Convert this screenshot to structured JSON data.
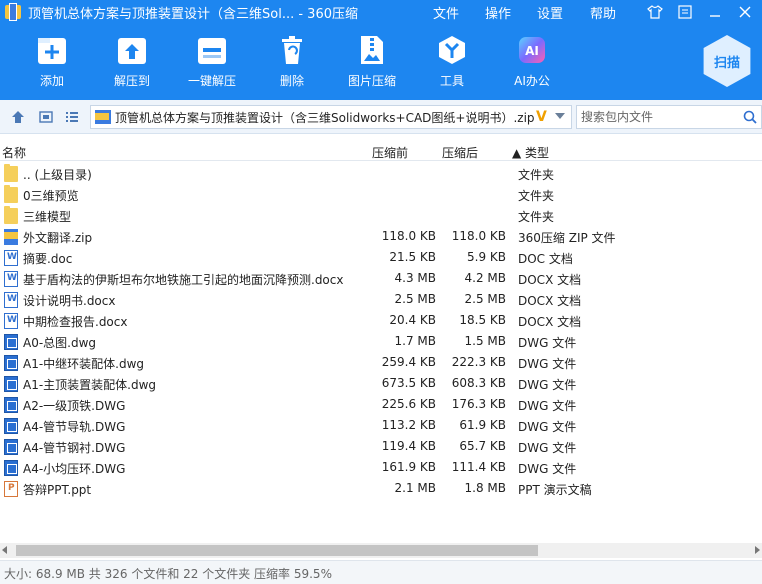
{
  "window": {
    "title": "顶管机总体方案与顶推装置设计（含三维Sol... - 360压缩",
    "menu": [
      "文件",
      "操作",
      "设置",
      "帮助"
    ]
  },
  "toolbar": {
    "add": "添加",
    "extract": "解压到",
    "one_click_extract": "一键解压",
    "delete": "删除",
    "image_compress": "图片压缩",
    "tools": "工具",
    "ai_office": "AI办公",
    "ai_badge": "AI",
    "scan": "扫描"
  },
  "address": {
    "path": "顶管机总体方案与顶推装置设计（含三维Solidworks+CAD图纸+说明书）.zip",
    "search_placeholder": "搜索包内文件"
  },
  "columns": {
    "name": "名称",
    "compressed_before": "压缩前",
    "compressed_after": "压缩后",
    "type": "▲ 类型"
  },
  "files": [
    {
      "name": ".. (上级目录)",
      "size_before": "",
      "size_after": "",
      "type": "文件夹",
      "icon": "folder-icon"
    },
    {
      "name": "0三维预览",
      "size_before": "",
      "size_after": "",
      "type": "文件夹",
      "icon": "folder-icon"
    },
    {
      "name": "三维模型",
      "size_before": "",
      "size_after": "",
      "type": "文件夹",
      "icon": "folder-icon"
    },
    {
      "name": "外文翻译.zip",
      "size_before": "118.0 KB",
      "size_after": "118.0 KB",
      "type": "360压缩 ZIP 文件",
      "icon": "zip-icon"
    },
    {
      "name": "摘要.doc",
      "size_before": "21.5 KB",
      "size_after": "5.9 KB",
      "type": "DOC 文档",
      "icon": "word-doc-icon"
    },
    {
      "name": "基于盾构法的伊斯坦布尔地铁施工引起的地面沉降预测.docx",
      "size_before": "4.3 MB",
      "size_after": "4.2 MB",
      "type": "DOCX 文档",
      "icon": "word-doc-icon"
    },
    {
      "name": "设计说明书.docx",
      "size_before": "2.5 MB",
      "size_after": "2.5 MB",
      "type": "DOCX 文档",
      "icon": "word-doc-icon"
    },
    {
      "name": "中期检查报告.docx",
      "size_before": "20.4 KB",
      "size_after": "18.5 KB",
      "type": "DOCX 文档",
      "icon": "word-doc-icon"
    },
    {
      "name": "A0-总图.dwg",
      "size_before": "1.7 MB",
      "size_after": "1.5 MB",
      "type": "DWG 文件",
      "icon": "dwg-icon"
    },
    {
      "name": "A1-中继环装配体.dwg",
      "size_before": "259.4 KB",
      "size_after": "222.3 KB",
      "type": "DWG 文件",
      "icon": "dwg-icon"
    },
    {
      "name": "A1-主顶装置装配体.dwg",
      "size_before": "673.5 KB",
      "size_after": "608.3 KB",
      "type": "DWG 文件",
      "icon": "dwg-icon"
    },
    {
      "name": "A2-一级顶铁.DWG",
      "size_before": "225.6 KB",
      "size_after": "176.3 KB",
      "type": "DWG 文件",
      "icon": "dwg-icon"
    },
    {
      "name": "A4-管节导轨.DWG",
      "size_before": "113.2 KB",
      "size_after": "61.9 KB",
      "type": "DWG 文件",
      "icon": "dwg-icon"
    },
    {
      "name": "A4-管节钢衬.DWG",
      "size_before": "119.4 KB",
      "size_after": "65.7 KB",
      "type": "DWG 文件",
      "icon": "dwg-icon"
    },
    {
      "name": "A4-小均压环.DWG",
      "size_before": "161.9 KB",
      "size_after": "111.4 KB",
      "type": "DWG 文件",
      "icon": "dwg-icon"
    },
    {
      "name": "答辩PPT.ppt",
      "size_before": "2.1 MB",
      "size_after": "1.8 MB",
      "type": "PPT 演示文稿",
      "icon": "ppt-icon"
    }
  ],
  "status": {
    "text": "大小: 68.9 MB 共 326 个文件和 22 个文件夹 压缩率 59.5%"
  }
}
